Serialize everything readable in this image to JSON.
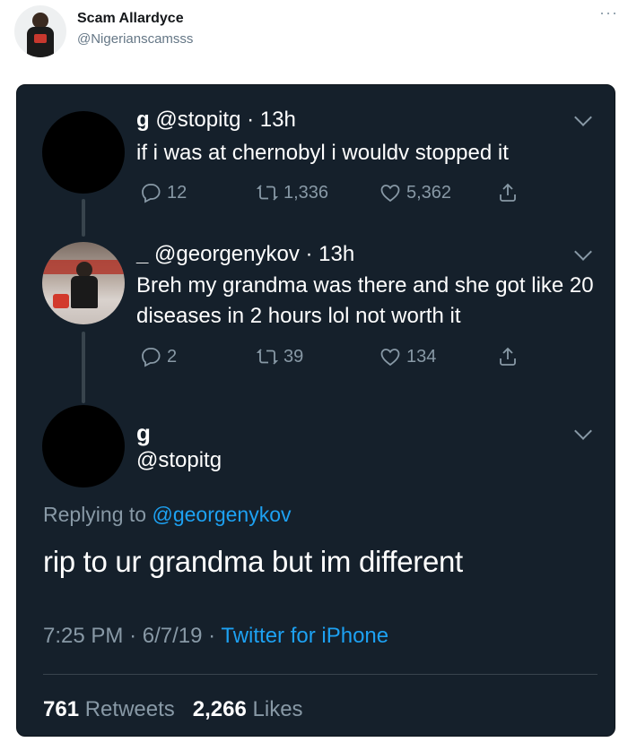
{
  "outer": {
    "name": "Scam Allardyce",
    "handle": "@Nigerianscamsss",
    "more": "···"
  },
  "thread": [
    {
      "name": "g",
      "handle": "@stopitg",
      "time": "13h",
      "text": "if i was at chernobyl i wouldv stopped it",
      "replies": "12",
      "retweets": "1,336",
      "likes": "5,362"
    },
    {
      "name": "_",
      "handle": "@georgenykov",
      "time": "13h",
      "text": "Breh my grandma was there and she got like 20 diseases in 2 hours lol not worth it",
      "replies": "2",
      "retweets": "39",
      "likes": "134"
    }
  ],
  "main": {
    "name": "g",
    "handle": "@stopitg",
    "replying_prefix": "Replying to",
    "replying_to": "@georgenykov",
    "text": "rip to ur grandma but im different",
    "time": "7:25 PM",
    "date": "6/7/19",
    "source": "Twitter for iPhone",
    "retweets_count": "761",
    "retweets_label": "Retweets",
    "likes_count": "2,266",
    "likes_label": "Likes"
  },
  "colors": {
    "card_bg": "#15202b",
    "link": "#1da1f2",
    "muted": "#8899a6"
  }
}
